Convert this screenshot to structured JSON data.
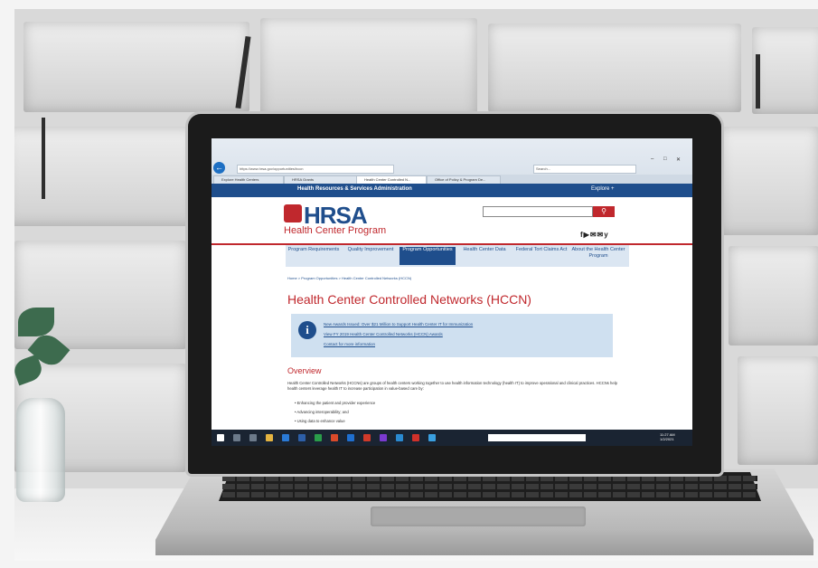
{
  "browser": {
    "url": "https://www.hrsa.gov/opportunities/hccn",
    "search_placeholder": "Search...",
    "tabs": [
      {
        "label": "Explore Health Centers"
      },
      {
        "label": "HRSA Grants"
      },
      {
        "label": "Health Center Controlled N..."
      },
      {
        "label": "Office of Policy & Program De..."
      }
    ],
    "window_controls": [
      "–",
      "□",
      "✕"
    ]
  },
  "site": {
    "top_bar_title": "Health Resources & Services Administration",
    "explore_label": "Explore +",
    "logo": "HRSA",
    "logo_subtitle": "Health Center Program",
    "socials": "f▶✉✉y",
    "nav": [
      {
        "label": "Program Requirements"
      },
      {
        "label": "Quality Improvement"
      },
      {
        "label": "Program Opportunities"
      },
      {
        "label": "Health Center Data"
      },
      {
        "label": "Federal Tort Claims Act"
      },
      {
        "label": "About the Health Center Program"
      }
    ],
    "breadcrumb": "Home > Program Opportunities > Health Center Controlled Networks (HCCN)",
    "page_title": "Health Center Controlled Networks (HCCN)",
    "info_lines": [
      "New Awards Issued: Over $21 Million to Support Health Center IT for Immunization",
      "View FY 2019 Health Center Controlled Networks (HCCN) Awards",
      "Contact for more information"
    ],
    "overview_heading": "Overview",
    "overview_text": "Health Center Controlled Networks (HCCNs) are groups of health centers working together to use health information technology (health IT) to improve operational and clinical practices. HCCNs help health centers leverage health IT to increase participation in value-based care by:",
    "bullets": [
      "Enhancing the patient and provider experience",
      "Advancing interoperability; and",
      "Using data to enhance value"
    ]
  },
  "taskbar": {
    "time": "11:27 AM",
    "date": "1/2/2021"
  }
}
